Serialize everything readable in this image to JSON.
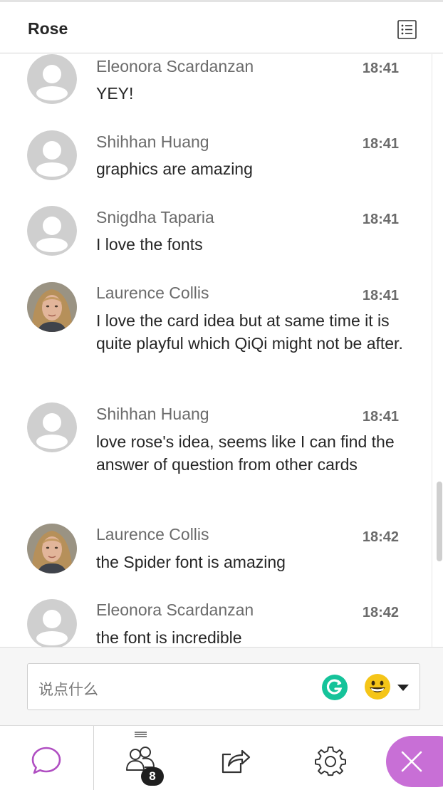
{
  "header": {
    "title": "Rose",
    "menu_icon": "list-icon"
  },
  "messages": [
    {
      "name": "Eleonora Scardanzan",
      "time": "18:41",
      "text": "YEY!",
      "avatar": "default"
    },
    {
      "name": "Shihhan Huang",
      "time": "18:41",
      "text": "graphics are amazing",
      "avatar": "default"
    },
    {
      "name": "Snigdha Taparia",
      "time": "18:41",
      "text": "I love the fonts",
      "avatar": "default"
    },
    {
      "name": "Laurence Collis",
      "time": "18:41",
      "text": "I love the card idea but at same time it is quite playful which QiQi might not be after.",
      "avatar": "photo"
    },
    {
      "name": "Shihhan Huang",
      "time": "18:41",
      "text": "love rose's idea, seems like I can find the answer of question from other cards",
      "avatar": "default"
    },
    {
      "name": "Laurence Collis",
      "time": "18:42",
      "text": "the Spider font is amazing",
      "avatar": "photo"
    },
    {
      "name": "Eleonora Scardanzan",
      "time": "18:42",
      "text": "the font is incredible",
      "avatar": "default"
    }
  ],
  "composer": {
    "placeholder": "说点什么",
    "grammarly_icon": "grammarly-icon",
    "emoji_icon": "smiley-emoji-icon"
  },
  "tabbar": {
    "participants_count": "8",
    "tabs": [
      "chat-icon",
      "participants-icon",
      "share-content-icon",
      "settings-icon",
      "close-icon"
    ]
  },
  "colors": {
    "accent": "#c86fd6",
    "chat_icon": "#b04fc2",
    "grammarly": "#15c39a",
    "emoji": "#f5c518"
  }
}
